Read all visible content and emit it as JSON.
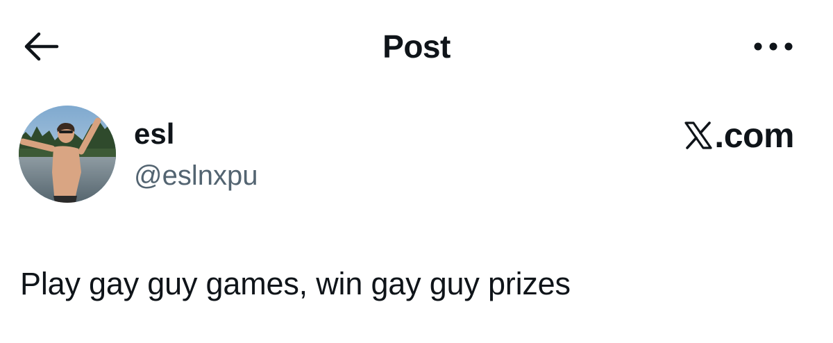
{
  "header": {
    "title": "Post",
    "back_icon": "arrow-left-icon",
    "more_icon": "more-horizontal-icon"
  },
  "author": {
    "display_name": "esl",
    "handle": "@eslnxpu",
    "avatar": "profile-photo"
  },
  "brand": {
    "icon": "x-logo-icon",
    "text": ".com"
  },
  "post": {
    "text": "Play gay guy games, win gay guy prizes"
  },
  "colors": {
    "text_primary": "#0f1419",
    "text_secondary": "#536471",
    "background": "#ffffff"
  }
}
